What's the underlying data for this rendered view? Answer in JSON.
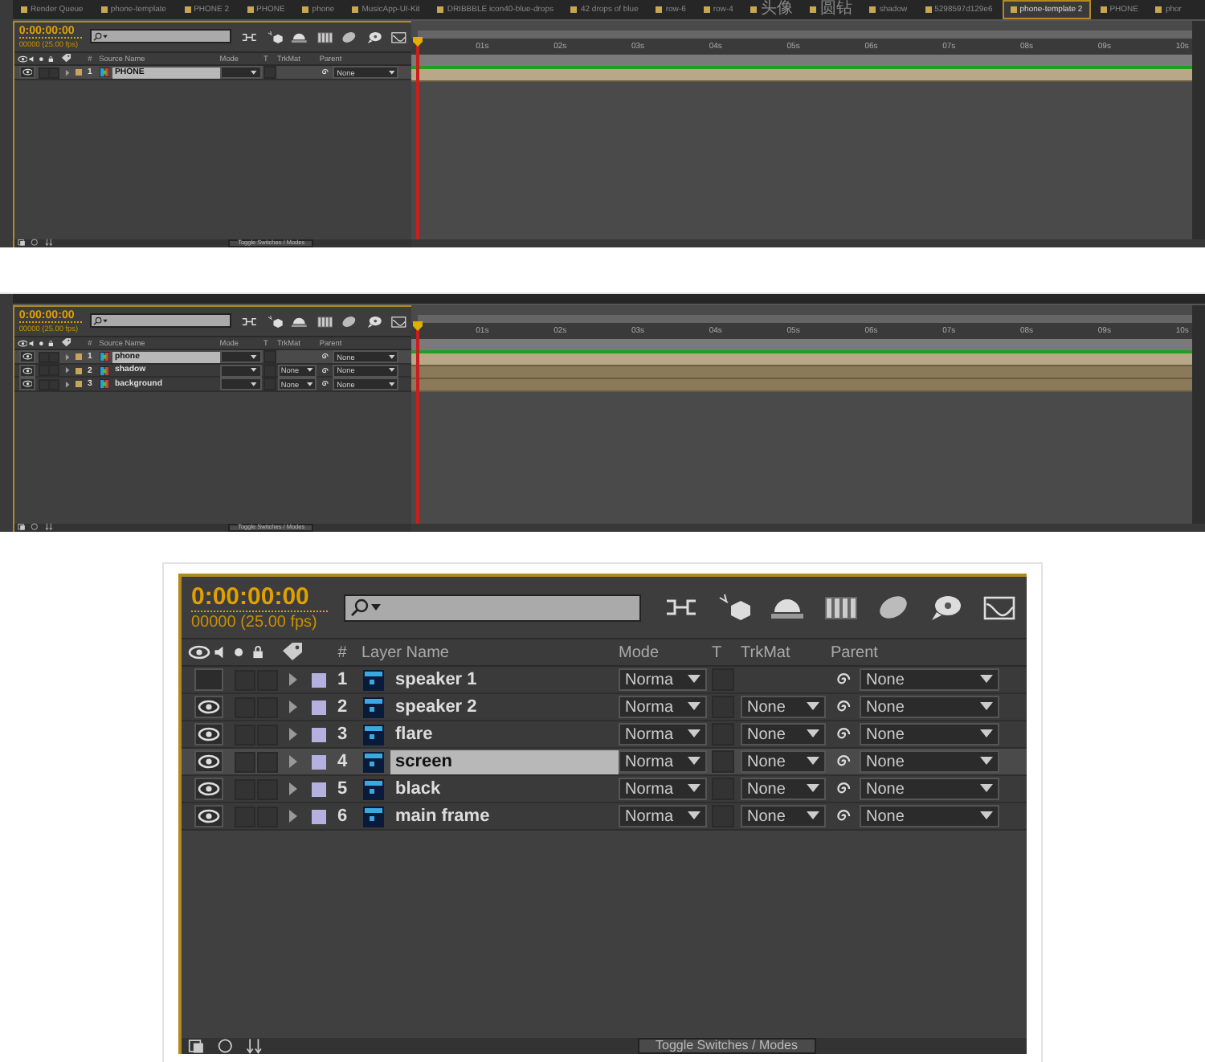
{
  "panels": [
    {
      "kind": "with-timeline",
      "tabs": [
        {
          "label": "Render Queue",
          "selected": false
        },
        {
          "label": "phone-template",
          "selected": false
        },
        {
          "label": "PHONE 2",
          "selected": false
        },
        {
          "label": "PHONE",
          "selected": false
        },
        {
          "label": "phone",
          "selected": false
        },
        {
          "label": "MusicApp-UI-Kit",
          "selected": false
        },
        {
          "label": "DRIBBBLE icon40-blue-drops",
          "selected": false
        },
        {
          "label": "42 drops of blue",
          "selected": false
        },
        {
          "label": "row-6",
          "selected": false
        },
        {
          "label": "row-4",
          "selected": false
        },
        {
          "label": "头像",
          "selected": false
        },
        {
          "label": "圆钻",
          "selected": false
        },
        {
          "label": "shadow",
          "selected": false
        },
        {
          "label": "5298597d129e6",
          "selected": false
        },
        {
          "label": "phone-template 2",
          "selected": true
        },
        {
          "label": "PHONE",
          "selected": false
        },
        {
          "label": "phor",
          "selected": false
        }
      ],
      "time": "0:00:00:00",
      "fps": "00000 (25.00 fps)",
      "columns": {
        "number": "#",
        "name": "Source Name",
        "mode": "Mode",
        "t": "T",
        "trkmat": "TrkMat",
        "parent": "Parent"
      },
      "layers": [
        {
          "kind": "comp",
          "number": "1",
          "name": "PHONE",
          "visible": true,
          "selected": true,
          "parent": "None"
        }
      ],
      "ruler": [
        "01s",
        "02s",
        "03s",
        "04s",
        "05s",
        "06s",
        "07s",
        "08s",
        "09s",
        "10s"
      ],
      "toggle": "Toggle Switches / Modes"
    },
    {
      "kind": "with-timeline",
      "time": "0:00:00:00",
      "fps": "00000 (25.00 fps)",
      "columns": {
        "number": "#",
        "name": "Source Name",
        "mode": "Mode",
        "t": "T",
        "trkmat": "TrkMat",
        "parent": "Parent"
      },
      "layers": [
        {
          "kind": "comp",
          "number": "1",
          "name": "phone",
          "visible": true,
          "selected": true,
          "parent": "None"
        },
        {
          "kind": "comp",
          "number": "2",
          "name": "shadow",
          "visible": true,
          "selected": false,
          "trkmat": "None",
          "parent": "None"
        },
        {
          "kind": "comp",
          "number": "3",
          "name": "background",
          "visible": true,
          "selected": false,
          "trkmat": "None",
          "parent": "None"
        }
      ],
      "ruler": [
        "01s",
        "02s",
        "03s",
        "04s",
        "05s",
        "06s",
        "07s",
        "08s",
        "09s",
        "10s"
      ],
      "toggle": "Toggle Switches / Modes"
    },
    {
      "kind": "layers-only",
      "time": "0:00:00:00",
      "fps": "00000 (25.00 fps)",
      "columns": {
        "number": "#",
        "name": "Layer Name",
        "mode": "Mode",
        "t": "T",
        "trkmat": "TrkMat",
        "parent": "Parent"
      },
      "layers": [
        {
          "kind": "psd",
          "number": "1",
          "name": "speaker 1",
          "visible": false,
          "selected": false,
          "mode": "Norma",
          "parent": "None"
        },
        {
          "kind": "psd",
          "number": "2",
          "name": "speaker 2",
          "visible": true,
          "selected": false,
          "mode": "Norma",
          "trkmat": "None",
          "parent": "None"
        },
        {
          "kind": "psd",
          "number": "3",
          "name": "flare",
          "visible": true,
          "selected": false,
          "mode": "Norma",
          "trkmat": "None",
          "parent": "None"
        },
        {
          "kind": "psd",
          "number": "4",
          "name": "screen",
          "visible": true,
          "selected": true,
          "mode": "Norma",
          "trkmat": "None",
          "parent": "None"
        },
        {
          "kind": "psd",
          "number": "5",
          "name": "black",
          "visible": true,
          "selected": false,
          "mode": "Norma",
          "trkmat": "None",
          "parent": "None"
        },
        {
          "kind": "psd",
          "number": "6",
          "name": "main frame",
          "visible": true,
          "selected": false,
          "mode": "Norma",
          "trkmat": "None",
          "parent": "None"
        }
      ],
      "toggle": "Toggle Switches / Modes"
    }
  ]
}
